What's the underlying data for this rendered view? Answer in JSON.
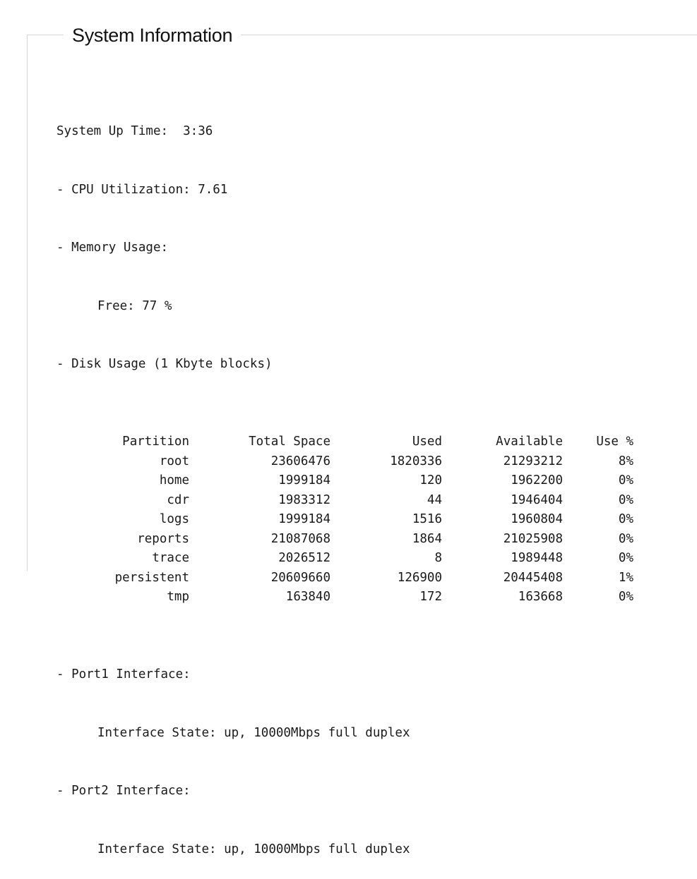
{
  "panel": {
    "title": "System Information"
  },
  "info": {
    "uptime_label": "System Up Time:",
    "uptime_value": "3:36",
    "cpu_label": "- CPU Utilization:",
    "cpu_value": "7.61",
    "memory_label": "- Memory Usage:",
    "memory_free_label": "Free:",
    "memory_free_value": "77 %",
    "disk_label": "- Disk Usage (1 Kbyte blocks)"
  },
  "disk": {
    "headers": [
      "Partition",
      "Total Space",
      "Used",
      "Available",
      "Use %"
    ],
    "rows": [
      [
        "root",
        "23606476",
        "1820336",
        "21293212",
        "8%"
      ],
      [
        "home",
        "1999184",
        "120",
        "1962200",
        "0%"
      ],
      [
        "cdr",
        "1983312",
        "44",
        "1946404",
        "0%"
      ],
      [
        "logs",
        "1999184",
        "1516",
        "1960804",
        "0%"
      ],
      [
        "reports",
        "21087068",
        "1864",
        "21025908",
        "0%"
      ],
      [
        "trace",
        "2026512",
        "8",
        "1989448",
        "0%"
      ],
      [
        "persistent",
        "20609660",
        "126900",
        "20445408",
        "1%"
      ],
      [
        "tmp",
        "163840",
        "172",
        "163668",
        "0%"
      ]
    ]
  },
  "ports": [
    {
      "label": "- Port1 Interface:",
      "state": "Interface State: up, 10000Mbps full duplex"
    },
    {
      "label": "- Port2 Interface:",
      "state": "Interface State: up, 10000Mbps full duplex"
    }
  ]
}
